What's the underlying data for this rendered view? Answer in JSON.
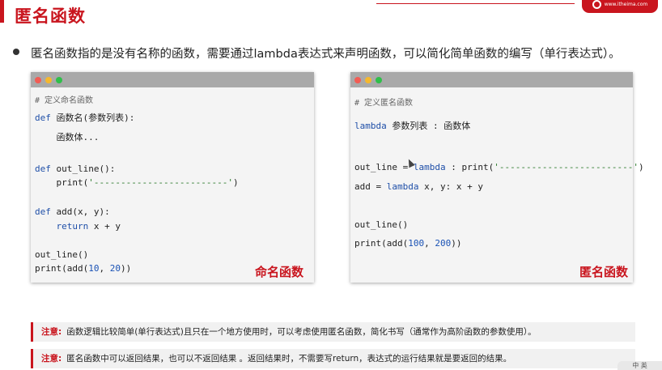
{
  "title": "匿名函数",
  "logo": {
    "text": "www.itheima.com",
    "icon": "brand-circle-icon"
  },
  "bullet": "匿名函数指的是没有名称的函数，需要通过lambda表达式来声明函数，可以简化简单函数的编写（单行表达式）。",
  "left_window": {
    "comment": "# 定义命名函数",
    "label": "命名函数",
    "lines": {
      "l1_kw": "def",
      "l1_rest": " 函数名(参数列表):",
      "l2": "    函数体...",
      "l3_kw": "def",
      "l3_rest": " out_line():",
      "l4_pre": "    print(",
      "l4_str": "'-------------------------'",
      "l4_post": ")",
      "l5_kw": "def",
      "l5_rest": " add(x, y):",
      "l6_kw": "    return",
      "l6_rest": " x + y",
      "l7": "out_line()",
      "l8_pre": "print(add(",
      "l8_n1": "10",
      "l8_mid": ", ",
      "l8_n2": "20",
      "l8_post": "))"
    }
  },
  "right_window": {
    "comment": "# 定义匿名函数",
    "label": "匿名函数",
    "lines": {
      "r1_kw": "lambda",
      "r1_rest": " 参数列表 : 函数体",
      "r2_pre": "out_line = ",
      "r2_kw": "lambda",
      "r2_mid": " : print(",
      "r2_str": "'-------------------------'",
      "r2_post": ")",
      "r3_pre": "add = ",
      "r3_kw": "lambda",
      "r3_rest": " x, y: x + y",
      "r4": "out_line()",
      "r5_pre": "print(add(",
      "r5_n1": "100",
      "r5_mid": ", ",
      "r5_n2": "200",
      "r5_post": "))"
    }
  },
  "notes": [
    {
      "label": "注意:",
      "text": "函数逻辑比较简单(单行表达式)且只在一个地方使用时，可以考虑使用匿名函数，简化书写（通常作为高阶函数的参数使用）。"
    },
    {
      "label": "注意:",
      "text": "匿名函数中可以返回结果，也可以不返回结果 。返回结果时，不需要写return，表达式的运行结果就是要返回的结果。"
    }
  ],
  "corner_widget": "中 英",
  "colors": {
    "accent": "#c9151e",
    "keyword": "#1f4fa8",
    "string": "#2a7a2a"
  }
}
